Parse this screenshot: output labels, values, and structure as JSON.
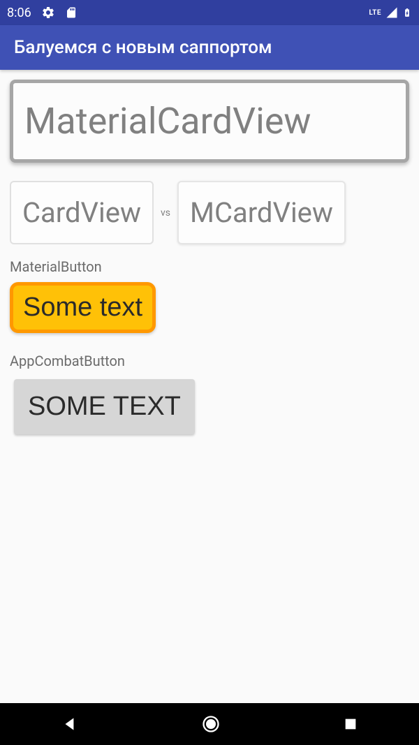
{
  "status_bar": {
    "time": "8:06",
    "lte": "LTE"
  },
  "app_bar": {
    "title": "Балуемся с новым саппортом"
  },
  "content": {
    "material_card_large": "MaterialCardView",
    "card_view": "CardView",
    "vs": "vs",
    "mcard_view": "MCardView",
    "material_button_label": "MaterialButton",
    "material_button_text": "Some text",
    "appcompat_button_label": "AppCombatButton",
    "appcompat_button_text": "SOME TEXT"
  },
  "colors": {
    "primary": "#3f51b5",
    "primary_dark": "#303f9f",
    "accent": "#ffc107",
    "accent_border": "#ff9800"
  }
}
